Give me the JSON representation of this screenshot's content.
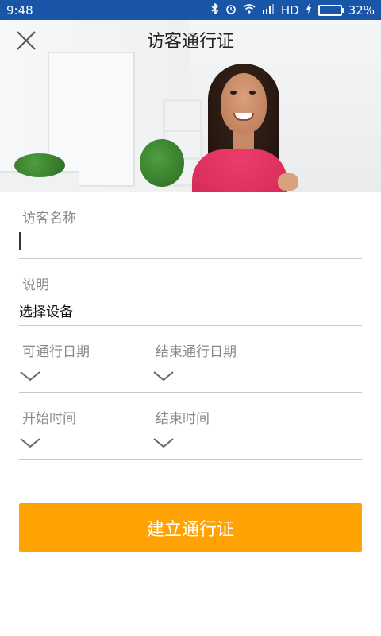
{
  "status_bar": {
    "time": "9:48",
    "network": "HD",
    "battery_percent": "32%",
    "battery_level": 0.32,
    "icons": [
      "bluetooth-icon",
      "alarm-icon",
      "wifi-icon",
      "signal-icon",
      "charging-icon",
      "battery-icon"
    ]
  },
  "header": {
    "title": "访客通行证",
    "close_icon": "close-icon"
  },
  "form": {
    "visitor_name_label": "访客名称",
    "visitor_name_value": "",
    "description_label": "说明",
    "select_device_text": "选择设备",
    "start_date_label": "可通行日期",
    "end_date_label": "结束通行日期",
    "start_time_label": "开始时间",
    "end_time_label": "结束时间"
  },
  "actions": {
    "submit_label": "建立通行证"
  },
  "colors": {
    "status_bar": "#1a56a8",
    "primary_button": "#ffa304",
    "divider": "#c9c9c9",
    "label": "#888888"
  }
}
